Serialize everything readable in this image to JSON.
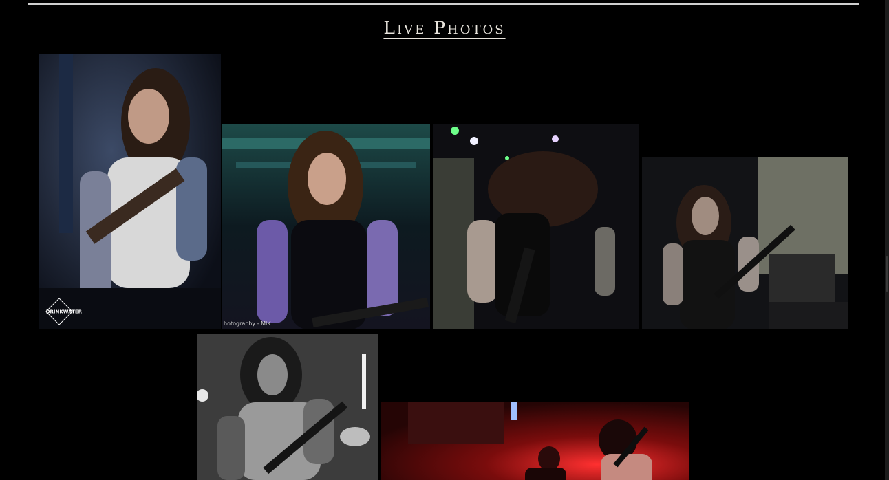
{
  "section": {
    "title": "Live Photos"
  },
  "photos": [
    {
      "id": "photo-1",
      "alt": "guitarist with tattoos in white tank top",
      "caption": "",
      "credit": "DRINKWATER"
    },
    {
      "id": "photo-2",
      "alt": "guitarist with long hair under green stage lights",
      "caption": "",
      "credit": "hotography - MIK"
    },
    {
      "id": "photo-3",
      "alt": "guitarist headbanging on stage",
      "caption": "",
      "credit": ""
    },
    {
      "id": "photo-4",
      "alt": "guitarist with 7-string guitar",
      "caption": "",
      "credit": ""
    },
    {
      "id": "photo-5",
      "alt": "black and white guitarist photo",
      "caption": "",
      "credit": ""
    },
    {
      "id": "photo-6",
      "alt": "band performing under red lights",
      "caption": "",
      "credit": ""
    }
  ],
  "colors": {
    "background": "#000000",
    "title": "#e8e4dc",
    "rule": "#cfcfcf"
  }
}
